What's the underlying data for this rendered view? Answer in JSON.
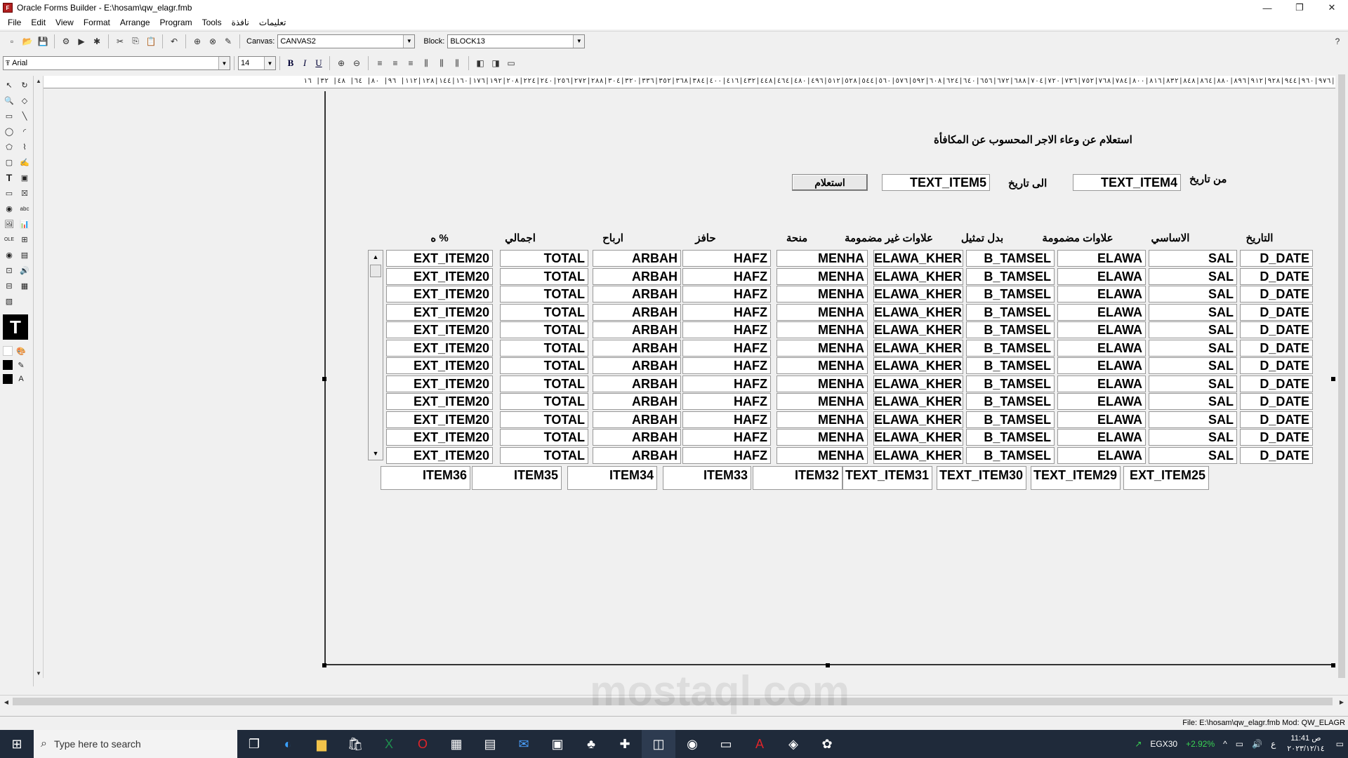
{
  "window": {
    "title": "Oracle Forms Builder - E:\\hosam\\qw_elagr.fmb",
    "minimize": "—",
    "restore": "❐",
    "close": "✕"
  },
  "menu": [
    "File",
    "Edit",
    "View",
    "Format",
    "Arrange",
    "Program",
    "Tools",
    "نافذة",
    "تعليمات"
  ],
  "toolbar": {
    "canvas_label": "Canvas:",
    "canvas_value": "CANVAS2",
    "block_label": "Block:",
    "block_value": "BLOCK13"
  },
  "format_bar": {
    "font_value": "Arial",
    "size_value": "14",
    "bold": "B",
    "italic": "I",
    "underline": "U"
  },
  "ruler_text": "٨٨| ٧٢| ٥٦| ٤٠| ٢٤| ٨٩٩٢|٩٧٦|٩٦٠|٩٤٤|٩٢٨|٩١٢|٨٩٦|٨٨٠|٨٦٤|٨٤٨|٨٣٢|٨١٦|٨٠٠|٧٨٤|٧٦٨|٧٥٢|٧٣٦|٧٢٠|٧٠٤|٦٨٨|٦٧٢|٦٥٦|٦٤٠|٦٢٤|٦٠٨|٥٩٢|٥٧٦|٥٦٠|٥٤٤|٥٢٨|٥١٢|٤٩٦|٤٨٠|٤٦٤|٤٤٨|٤٣٢|٤١٦|٤٠٠|٣٨٤|٣٦٨|٣٥٢|٣٣٦|٣٢٠|٣٠٤|٢٨٨|٢٧٢|٢٥٦|٢٤٠|٢٢٤|٢٠٨|١٩٢|١٧٦|١٦٠|١٤٤|١٢٨|١١٢| ٩٦| ٨٠| ٦٤| ٤٨| ٣٢| ١٦",
  "form": {
    "title": "استعلام عن وعاء الاجر المحسوب عن المكافأة",
    "from_date_label": "من تاريخ",
    "from_date_field": "TEXT_ITEM4",
    "to_date_label": "الى تاريخ",
    "to_date_field": "TEXT_ITEM5",
    "query_button": "استعلام",
    "headers": [
      "التاريخ",
      "الاساسي",
      "علاوات مضمومة",
      "بدل تمثيل",
      "علاوات غير مضمومة",
      "منحة",
      "حافز",
      "ارباح",
      "اجمالي",
      "% ه"
    ],
    "row_cells": [
      "D_DATE",
      "SAL",
      "ELAWA",
      "B_TAMSEL",
      "ELAWA_KHER",
      "MENHA",
      "HAFZ",
      "ARBAH",
      "TOTAL",
      "EXT_ITEM20"
    ],
    "rows": [
      [
        "D_DATE",
        "SAL",
        "ELAWA",
        "B_TAMSEL",
        "ELAWA_KHER",
        "MENHA",
        "HAFZ",
        "ARBAH",
        "TOTAL",
        "EXT_ITEM20"
      ],
      [
        "D_DATE",
        "SAL",
        "ELAWA",
        "B_TAMSEL",
        "ELAWA_KHER",
        "MENHA",
        "HAFZ",
        "ARBAH",
        "TOTAL",
        "EXT_ITEM20"
      ],
      [
        "D_DATE",
        "SAL",
        "ELAWA",
        "B_TAMSEL",
        "ELAWA_KHER",
        "MENHA",
        "HAFZ",
        "ARBAH",
        "TOTAL",
        "EXT_ITEM20"
      ],
      [
        "D_DATE",
        "SAL",
        "ELAWA",
        "B_TAMSEL",
        "ELAWA_KHER",
        "MENHA",
        "HAFZ",
        "ARBAH",
        "TOTAL",
        "EXT_ITEM20"
      ],
      [
        "D_DATE",
        "SAL",
        "ELAWA",
        "B_TAMSEL",
        "ELAWA_KHER",
        "MENHA",
        "HAFZ",
        "ARBAH",
        "TOTAL",
        "EXT_ITEM20"
      ],
      [
        "D_DATE",
        "SAL",
        "ELAWA",
        "B_TAMSEL",
        "ELAWA_KHER",
        "MENHA",
        "HAFZ",
        "ARBAH",
        "TOTAL",
        "EXT_ITEM20"
      ],
      [
        "D_DATE",
        "SAL",
        "ELAWA",
        "B_TAMSEL",
        "ELAWA_KHER",
        "MENHA",
        "HAFZ",
        "ARBAH",
        "TOTAL",
        "EXT_ITEM20"
      ],
      [
        "D_DATE",
        "SAL",
        "ELAWA",
        "B_TAMSEL",
        "ELAWA_KHER",
        "MENHA",
        "HAFZ",
        "ARBAH",
        "TOTAL",
        "EXT_ITEM20"
      ],
      [
        "D_DATE",
        "SAL",
        "ELAWA",
        "B_TAMSEL",
        "ELAWA_KHER",
        "MENHA",
        "HAFZ",
        "ARBAH",
        "TOTAL",
        "EXT_ITEM20"
      ],
      [
        "D_DATE",
        "SAL",
        "ELAWA",
        "B_TAMSEL",
        "ELAWA_KHER",
        "MENHA",
        "HAFZ",
        "ARBAH",
        "TOTAL",
        "EXT_ITEM20"
      ],
      [
        "D_DATE",
        "SAL",
        "ELAWA",
        "B_TAMSEL",
        "ELAWA_KHER",
        "MENHA",
        "HAFZ",
        "ARBAH",
        "TOTAL",
        "EXT_ITEM20"
      ],
      [
        "D_DATE",
        "SAL",
        "ELAWA",
        "B_TAMSEL",
        "ELAWA_KHER",
        "MENHA",
        "HAFZ",
        "ARBAH",
        "TOTAL",
        "EXT_ITEM20"
      ]
    ],
    "totals": [
      "EXT_ITEM25",
      "TEXT_ITEM29",
      "TEXT_ITEM30",
      "TEXT_ITEM31",
      "ITEM32",
      "ITEM33",
      "ITEM34",
      "ITEM35",
      "ITEM36"
    ]
  },
  "status": {
    "text": "File: E:\\hosam\\qw_elagr.fmb  Mod: QW_ELAGR"
  },
  "taskbar": {
    "search_placeholder": "Type here to search",
    "stock": "EGX30",
    "stock_change": "+2.92%",
    "lang": "ع",
    "time": "11:41 ص",
    "date": "٢٠٢٣/١٢/١٤"
  },
  "watermark": "mostaql.com",
  "colors": {
    "taskbar_bg": "#1f2a3a",
    "stock_up": "#39d353"
  }
}
